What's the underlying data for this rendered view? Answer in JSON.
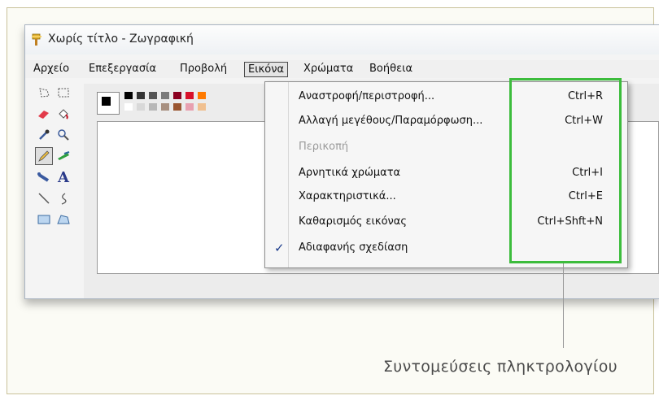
{
  "window": {
    "title": "Χωρίς τίτλο - Ζωγραφική"
  },
  "menubar": {
    "items": [
      {
        "label": "Αρχείο"
      },
      {
        "label": "Επεξεργασία"
      },
      {
        "label": "Προβολή"
      },
      {
        "label": "Εικόνα"
      },
      {
        "label": "Χρώματα"
      },
      {
        "label": "Βοήθεια"
      }
    ]
  },
  "image_menu": {
    "items": [
      {
        "label": "Αναστροφή/περιστροφή...",
        "shortcut": "Ctrl+R",
        "enabled": true,
        "checked": false
      },
      {
        "label": "Αλλαγή μεγέθους/Παραμόρφωση...",
        "shortcut": "Ctrl+W",
        "enabled": true,
        "checked": false
      },
      {
        "label": "Περικοπή",
        "shortcut": "",
        "enabled": false,
        "checked": false
      },
      {
        "label": "Αρνητικά χρώματα",
        "shortcut": "Ctrl+I",
        "enabled": true,
        "checked": false
      },
      {
        "label": "Χαρακτηριστικά...",
        "shortcut": "Ctrl+E",
        "enabled": true,
        "checked": false
      },
      {
        "label": "Καθαρισμός εικόνας",
        "shortcut": "Ctrl+Shft+N",
        "enabled": true,
        "checked": false
      },
      {
        "label": "Αδιαφανής σχεδίαση",
        "shortcut": "",
        "enabled": true,
        "checked": true
      }
    ]
  },
  "callout": {
    "text": "Συντομεύσεις πληκτρολογίου"
  },
  "colors": {
    "highlight": "#3cbc3c",
    "palette_top": [
      "#000000",
      "#333333",
      "#555555",
      "#7a7a7a",
      "#8b0020",
      "#d8102a",
      "#ff7a00"
    ],
    "palette_bottom": [
      "#ffffff",
      "#d8d8d8",
      "#b8b8b8",
      "#a89080",
      "#9a5530",
      "#e8a0b0",
      "#f0c090"
    ]
  },
  "tools": [
    "free-select",
    "rect-select",
    "eraser",
    "fill",
    "picker",
    "magnifier",
    "pencil",
    "brush",
    "airbrush",
    "text",
    "line",
    "curve",
    "rectangle",
    "polygon"
  ]
}
